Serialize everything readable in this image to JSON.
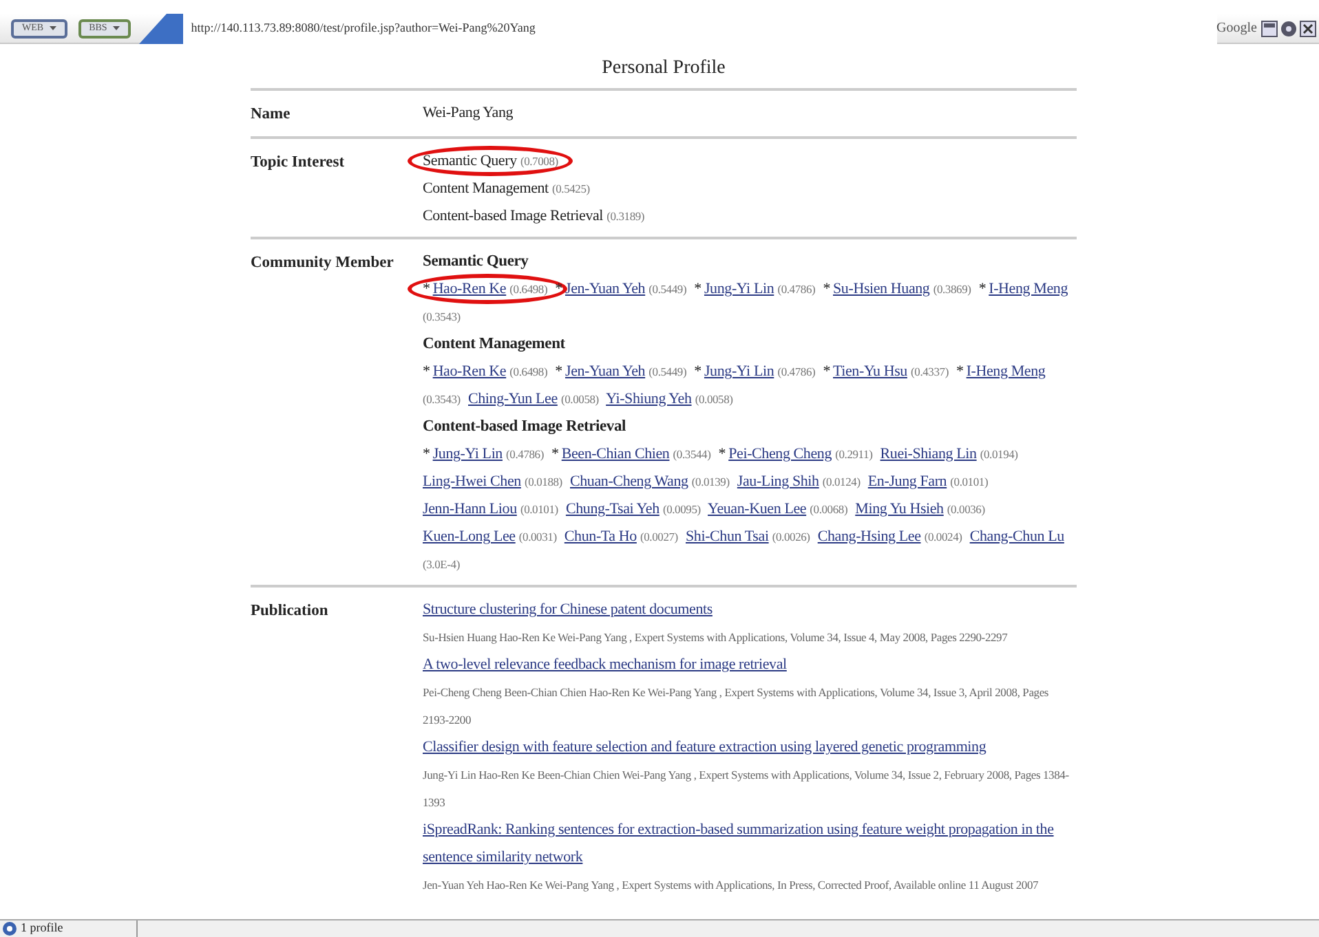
{
  "browser": {
    "buttons": [
      {
        "label": "WEB"
      },
      {
        "label": "BBS"
      }
    ],
    "url": "http://140.113.73.89:8080/test/profile.jsp?author=Wei-Pang%20Yang",
    "search_engine": "Google"
  },
  "title": "Personal Profile",
  "name": {
    "label": "Name",
    "value": "Wei-Pang Yang"
  },
  "topics": {
    "label": "Topic Interest",
    "items": [
      {
        "name": "Semantic Query",
        "score": "(0.7008)",
        "circled": true
      },
      {
        "name": "Content Management",
        "score": "(0.5425)",
        "circled": false
      },
      {
        "name": "Content-based Image Retrieval",
        "score": "(0.3189)",
        "circled": false
      }
    ]
  },
  "community": {
    "label": "Community Member",
    "groups": [
      {
        "topic": "Semantic Query",
        "members": [
          {
            "star": "*",
            "name": "Hao-Ren Ke",
            "score": "(0.6498)",
            "circled": true
          },
          {
            "star": "*",
            "name": "Jen-Yuan Yeh",
            "score": "(0.5449)",
            "circled": false
          },
          {
            "star": "*",
            "name": "Jung-Yi Lin",
            "score": "(0.4786)",
            "circled": false
          },
          {
            "star": "*",
            "name": "Su-Hsien Huang",
            "score": "(0.3869)",
            "circled": false
          },
          {
            "star": "*",
            "name": "I-Heng Meng",
            "score": "(0.3543)",
            "circled": false
          }
        ]
      },
      {
        "topic": "Content Management",
        "members": [
          {
            "star": "*",
            "name": "Hao-Ren Ke",
            "score": "(0.6498)",
            "circled": false
          },
          {
            "star": "*",
            "name": "Jen-Yuan Yeh",
            "score": "(0.5449)",
            "circled": false
          },
          {
            "star": "*",
            "name": "Jung-Yi Lin",
            "score": "(0.4786)",
            "circled": false
          },
          {
            "star": "*",
            "name": "Tien-Yu Hsu",
            "score": "(0.4337)",
            "circled": false
          },
          {
            "star": "*",
            "name": "I-Heng Meng",
            "score": "(0.3543)",
            "circled": false
          },
          {
            "name": "Ching-Yun Lee",
            "score": "(0.0058)",
            "circled": false
          },
          {
            "name": "Yi-Shiung Yeh",
            "score": "(0.0058)",
            "circled": false
          }
        ]
      },
      {
        "topic": "Content-based Image Retrieval",
        "members": [
          {
            "star": "*",
            "name": "Jung-Yi Lin",
            "score": "(0.4786)",
            "circled": false
          },
          {
            "star": "*",
            "name": "Been-Chian Chien",
            "score": "(0.3544)",
            "circled": false
          },
          {
            "star": "*",
            "name": "Pei-Cheng Cheng",
            "score": "(0.2911)",
            "circled": false
          },
          {
            "name": "Ruei-Shiang Lin",
            "score": "(0.0194)",
            "circled": false
          },
          {
            "name": "Ling-Hwei Chen",
            "score": "(0.0188)",
            "circled": false
          },
          {
            "name": "Chuan-Cheng Wang",
            "score": "(0.0139)",
            "circled": false
          },
          {
            "name": "Jau-Ling Shih",
            "score": "(0.0124)",
            "circled": false
          },
          {
            "name": "En-Jung Farn",
            "score": "(0.0101)",
            "circled": false
          },
          {
            "name": "Jenn-Hann Liou",
            "score": "(0.0101)",
            "circled": false
          },
          {
            "name": "Chung-Tsai Yeh",
            "score": "(0.0095)",
            "circled": false
          },
          {
            "name": "Yeuan-Kuen Lee",
            "score": "(0.0068)",
            "circled": false
          },
          {
            "name": "Ming Yu Hsieh",
            "score": "(0.0036)",
            "circled": false
          },
          {
            "name": "Kuen-Long Lee",
            "score": "(0.0031)",
            "circled": false
          },
          {
            "name": "Chun-Ta Ho",
            "score": "(0.0027)",
            "circled": false
          },
          {
            "name": "Shi-Chun Tsai",
            "score": "(0.0026)",
            "circled": false
          },
          {
            "name": "Chang-Hsing Lee",
            "score": "(0.0024)",
            "circled": false
          },
          {
            "name": "Chang-Chun Lu",
            "score": "(3.0E-4)",
            "circled": false
          }
        ]
      }
    ]
  },
  "publications": {
    "label": "Publication",
    "items": [
      {
        "title": "Structure clustering for Chinese patent documents",
        "details": "Su-Hsien Huang Hao-Ren Ke Wei-Pang Yang , Expert Systems with Applications, Volume 34, Issue 4, May 2008, Pages 2290-2297"
      },
      {
        "title": "A two-level relevance feedback mechanism for image retrieval",
        "details": "Pei-Cheng Cheng Been-Chian Chien Hao-Ren Ke Wei-Pang Yang , Expert Systems with Applications, Volume 34, Issue 3, April 2008, Pages 2193-2200"
      },
      {
        "title": "Classifier design with feature selection and feature extraction using layered genetic programming",
        "details": "Jung-Yi Lin Hao-Ren Ke Been-Chian Chien Wei-Pang Yang , Expert Systems with Applications, Volume 34, Issue 2, February 2008, Pages 1384-1393"
      },
      {
        "title": "iSpreadRank: Ranking sentences for extraction-based summarization using feature weight propagation in the sentence similarity network",
        "details": "Jen-Yuan Yeh Hao-Ren Ke Wei-Pang Yang , Expert Systems with Applications, In Press, Corrected Proof, Available online 11 August 2007"
      }
    ]
  },
  "status_bar": {
    "text": "1 profile"
  }
}
